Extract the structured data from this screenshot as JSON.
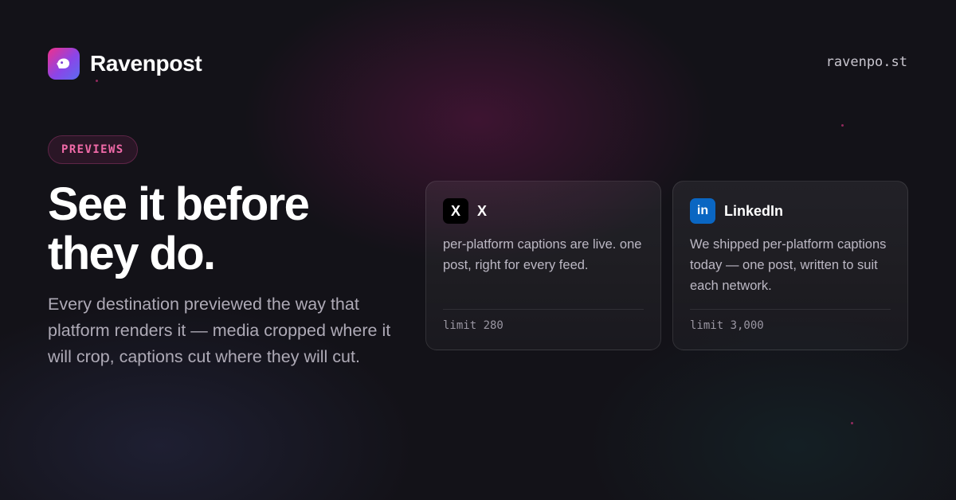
{
  "brand": {
    "name": "Ravenpost",
    "domain": "ravenpo.st"
  },
  "badge": "PREVIEWS",
  "headline": {
    "line1": "See it before",
    "line2": "they do."
  },
  "subhead": "Every destination previewed the way that platform renders it — media cropped where it will crop, captions cut where they will cut.",
  "icons": {
    "logo": "raven-bird-icon",
    "x": "x-logo-icon",
    "linkedin": "linkedin-logo-icon"
  },
  "colors": {
    "accent_pink": "#f06aa8",
    "background": "#131218",
    "x_tile": "#000000",
    "linkedin_tile": "#0a66c2"
  },
  "cards": [
    {
      "platform": "X",
      "icon_text": "X",
      "caption": "per-platform captions are live. one post, right for every feed.",
      "limit": "limit 280"
    },
    {
      "platform": "LinkedIn",
      "icon_text": "in",
      "caption": "We shipped per-platform captions today — one post, written to suit each network.",
      "limit": "limit 3,000"
    }
  ]
}
